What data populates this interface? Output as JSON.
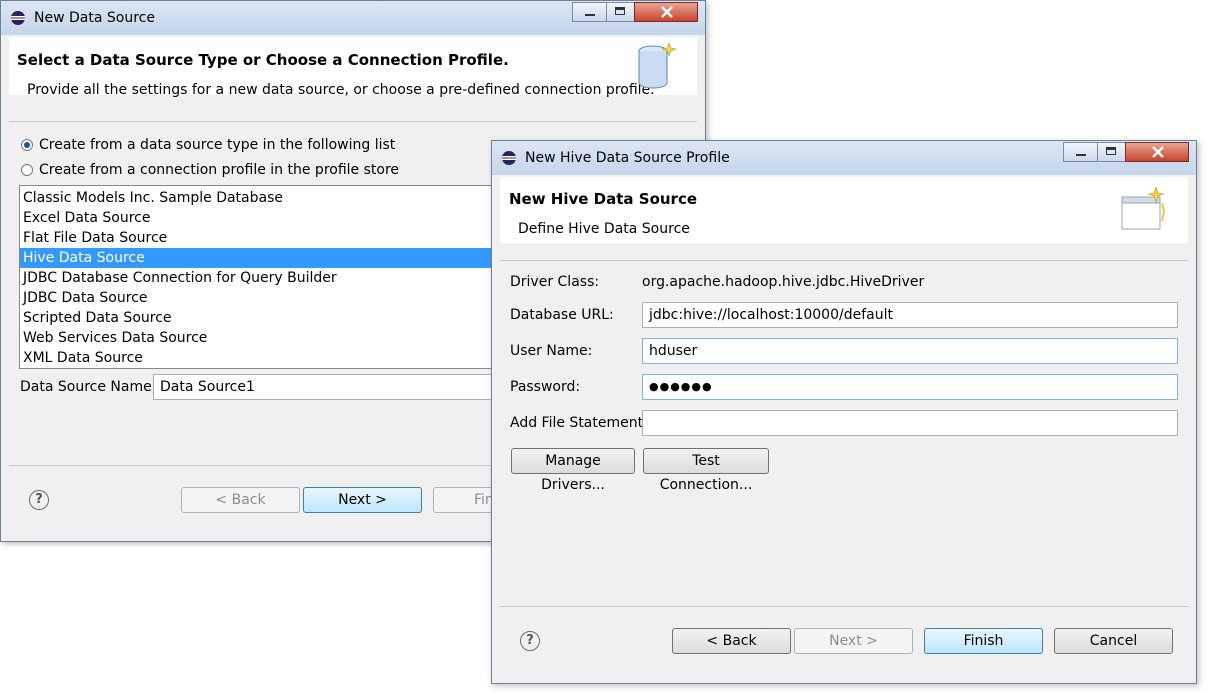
{
  "back_window": {
    "title": "New Data Source",
    "header_title": "Select a Data Source Type or Choose a Connection Profile.",
    "header_desc": "Provide all the settings for a new data source, or choose a pre-defined connection profile.",
    "radio_type": "Create from a data source type in the following list",
    "radio_profile": "Create from a connection profile in the profile store",
    "list_items": [
      "Classic Models Inc. Sample Database",
      "Excel Data Source",
      "Flat File Data Source",
      "Hive Data Source",
      "JDBC Database Connection for Query Builder",
      "JDBC Data Source",
      "Scripted Data Source",
      "Web Services Data Source",
      "XML Data Source"
    ],
    "selected_item": "Hive Data Source",
    "name_label": "Data Source Name:",
    "name_value": "Data Source1",
    "back_label": "< Back",
    "next_label": "Next >",
    "finish_label": "Fin"
  },
  "front_window": {
    "title": "New Hive Data Source Profile",
    "header_title": "New Hive Data Source",
    "header_desc": "Define Hive Data Source",
    "driver_label": "Driver Class:",
    "driver_value": "org.apache.hadoop.hive.jdbc.HiveDriver",
    "url_label": "Database URL:",
    "url_value": "jdbc:hive://localhost:10000/default",
    "user_label": "User Name:",
    "user_value": "hduser",
    "password_label": "Password:",
    "password_value": "●●●●●●",
    "file_label": "Add File Statement",
    "file_value": "",
    "manage_label": "Manage Drivers...",
    "test_label": "Test Connection...",
    "back_label": "< Back",
    "next_label": "Next >",
    "finish_label": "Finish",
    "cancel_label": "Cancel"
  }
}
